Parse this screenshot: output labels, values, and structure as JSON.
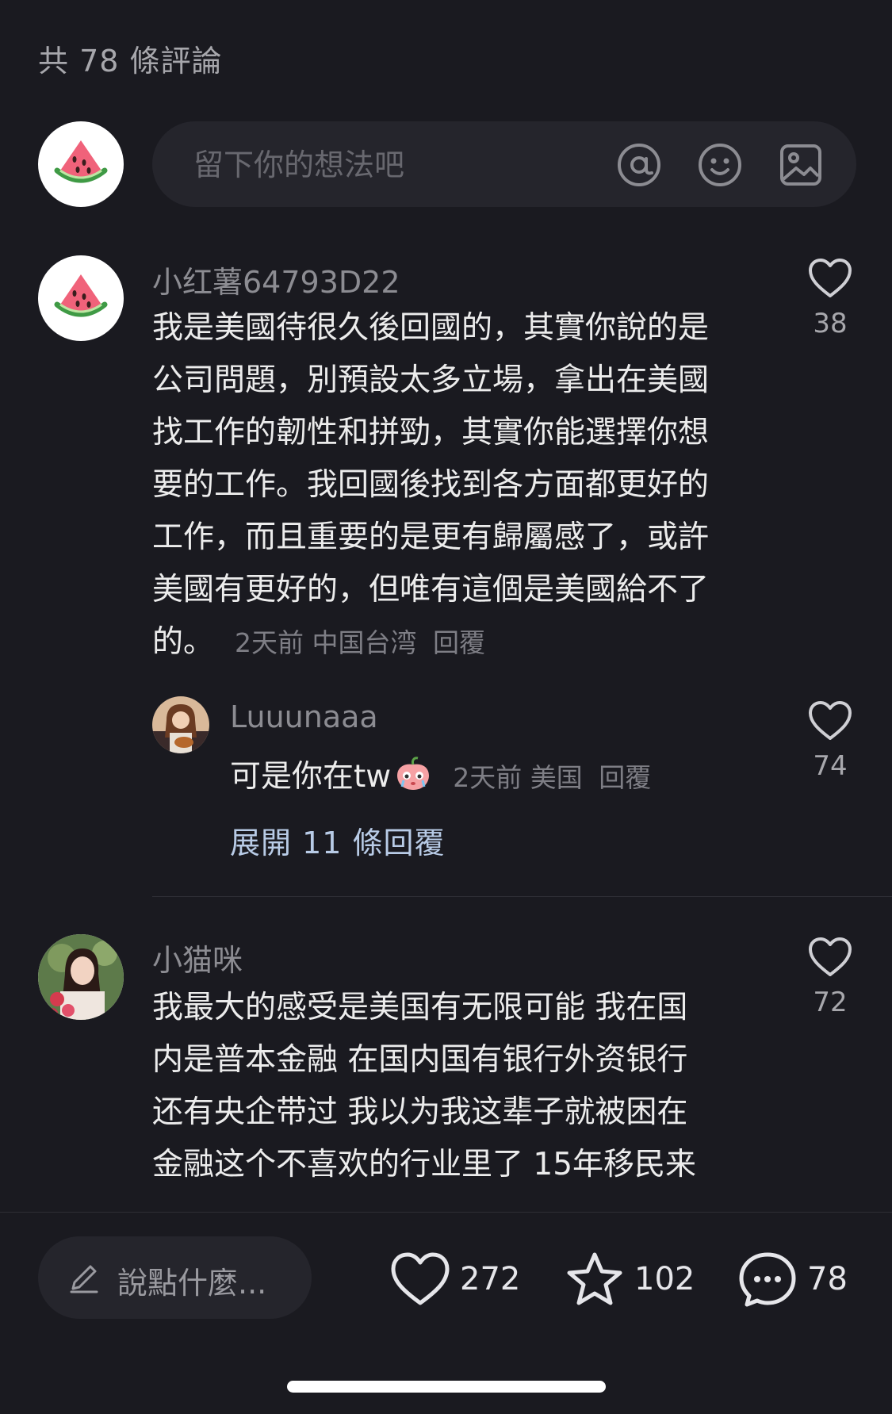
{
  "header": {
    "comment_count_title": "共 78 條評論"
  },
  "composer": {
    "placeholder": "留下你的想法吧",
    "icons": [
      "at-icon",
      "emoji-icon",
      "image-icon"
    ]
  },
  "comments": [
    {
      "username": "小红薯64793D22",
      "avatar": "watermelon-avatar",
      "text": "我是美國待很久後回國的，其實你說的是公司問題，別預設太多立場，拿出在美國找工作的韌性和拼勁，其實你能選擇你想要的工作。我回國後找到各方面都更好的工作，而且重要的是更有歸屬感了，或許美國有更好的，但唯有這個是美國給不了的。",
      "time": "2天前",
      "location": "中国台湾",
      "reply_label": "回覆",
      "likes": "38",
      "replies": [
        {
          "username": "Luuunaaa",
          "avatar": "woman-with-guitar-avatar",
          "text": "可是你在tw",
          "emoji": "crying-peach-emoji",
          "time": "2天前",
          "location": "美国",
          "reply_label": "回覆",
          "likes": "74"
        }
      ],
      "expand_label": "展開 11 條回覆"
    },
    {
      "username": "小猫咪",
      "avatar": "woman-with-roses-avatar",
      "text_lines": [
        "我最大的感受是美国有无限可能 我在国",
        "内是普本金融 在国内国有银行外资银行",
        "还有央企带过 我以为我这辈子就被困在",
        "金融这个不喜欢的行业里了 15年移民来"
      ],
      "likes": "72"
    }
  ],
  "bottom_bar": {
    "say_placeholder": "說點什麼...",
    "like_count": "272",
    "favorite_count": "102",
    "comment_count": "78"
  },
  "colors": {
    "background": "#1a1a20",
    "input_bg": "#25252c",
    "text": "#ececec",
    "muted": "#8c8c92",
    "link": "#b8cbe6"
  }
}
